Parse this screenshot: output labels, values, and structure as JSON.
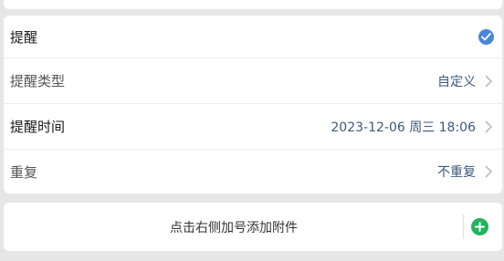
{
  "reminder": {
    "toggle_label": "提醒",
    "enabled": true,
    "type_label": "提醒类型",
    "type_value": "自定义",
    "time_label": "提醒时间",
    "time_value": "2023-12-06 周三 18:06",
    "repeat_label": "重复",
    "repeat_value": "不重复"
  },
  "attachment": {
    "hint": "点击右侧加号添加附件"
  },
  "colors": {
    "check": "#4a86d9",
    "add": "#22b35e",
    "value_text": "#3d5a78"
  },
  "icons": [
    "checkmark-icon",
    "chevron-right-icon",
    "plus-icon"
  ]
}
